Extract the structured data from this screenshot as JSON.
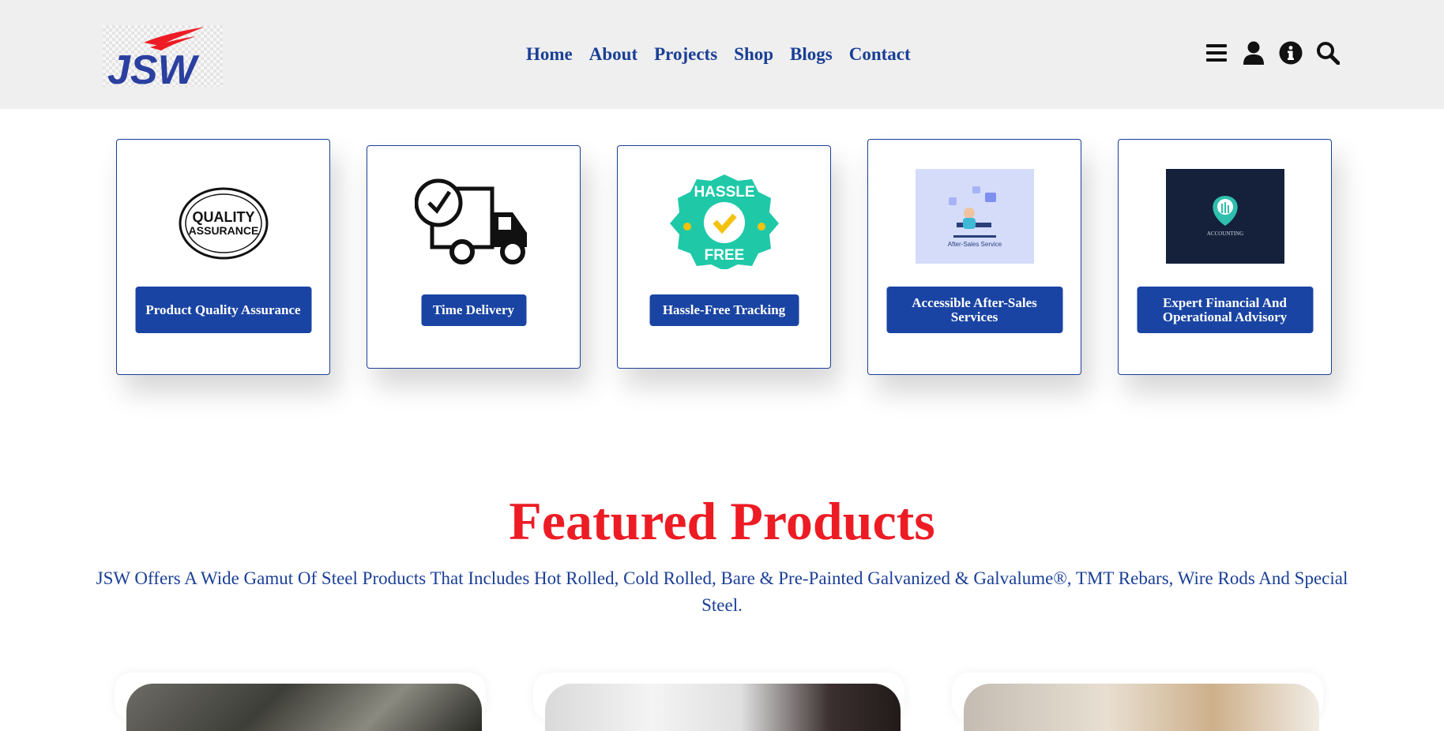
{
  "header": {
    "logo_text": "JSW",
    "nav": [
      {
        "label": "Home"
      },
      {
        "label": "About"
      },
      {
        "label": "Projects"
      },
      {
        "label": "Shop"
      },
      {
        "label": "Blogs"
      },
      {
        "label": "Contact"
      }
    ],
    "icons": [
      "menu-icon",
      "user-icon",
      "info-icon",
      "search-icon"
    ]
  },
  "features": [
    {
      "label": "Product Quality Assurance",
      "image": "quality-assurance-stamp",
      "image_text": [
        "QUALITY",
        "ASSURANCE"
      ]
    },
    {
      "label": "Time Delivery",
      "image": "delivery-truck-clock"
    },
    {
      "label": "Hassle-Free Tracking",
      "image": "hassle-free-badge",
      "image_text": [
        "HASSLE",
        "FREE"
      ]
    },
    {
      "label": "Accessible After-Sales Services",
      "image": "after-sales-service-illustration",
      "image_text": [
        "After-Sales Service"
      ]
    },
    {
      "label": "Expert Financial And Operational Advisory",
      "image": "accounting-logo",
      "image_text": [
        "ACCOUNTING"
      ]
    }
  ],
  "featured": {
    "title": "Featured Products",
    "description": "JSW Offers A Wide Gamut Of Steel Products That Includes Hot Rolled, Cold Rolled, Bare & Pre-Painted Galvanized & Galvalume®, TMT Rebars, Wire Rods And Special Steel."
  },
  "colors": {
    "brand_blue": "#1a3f95",
    "button_blue": "#1a44a3",
    "accent_red": "#ed1c24",
    "header_bg": "#efefef"
  }
}
